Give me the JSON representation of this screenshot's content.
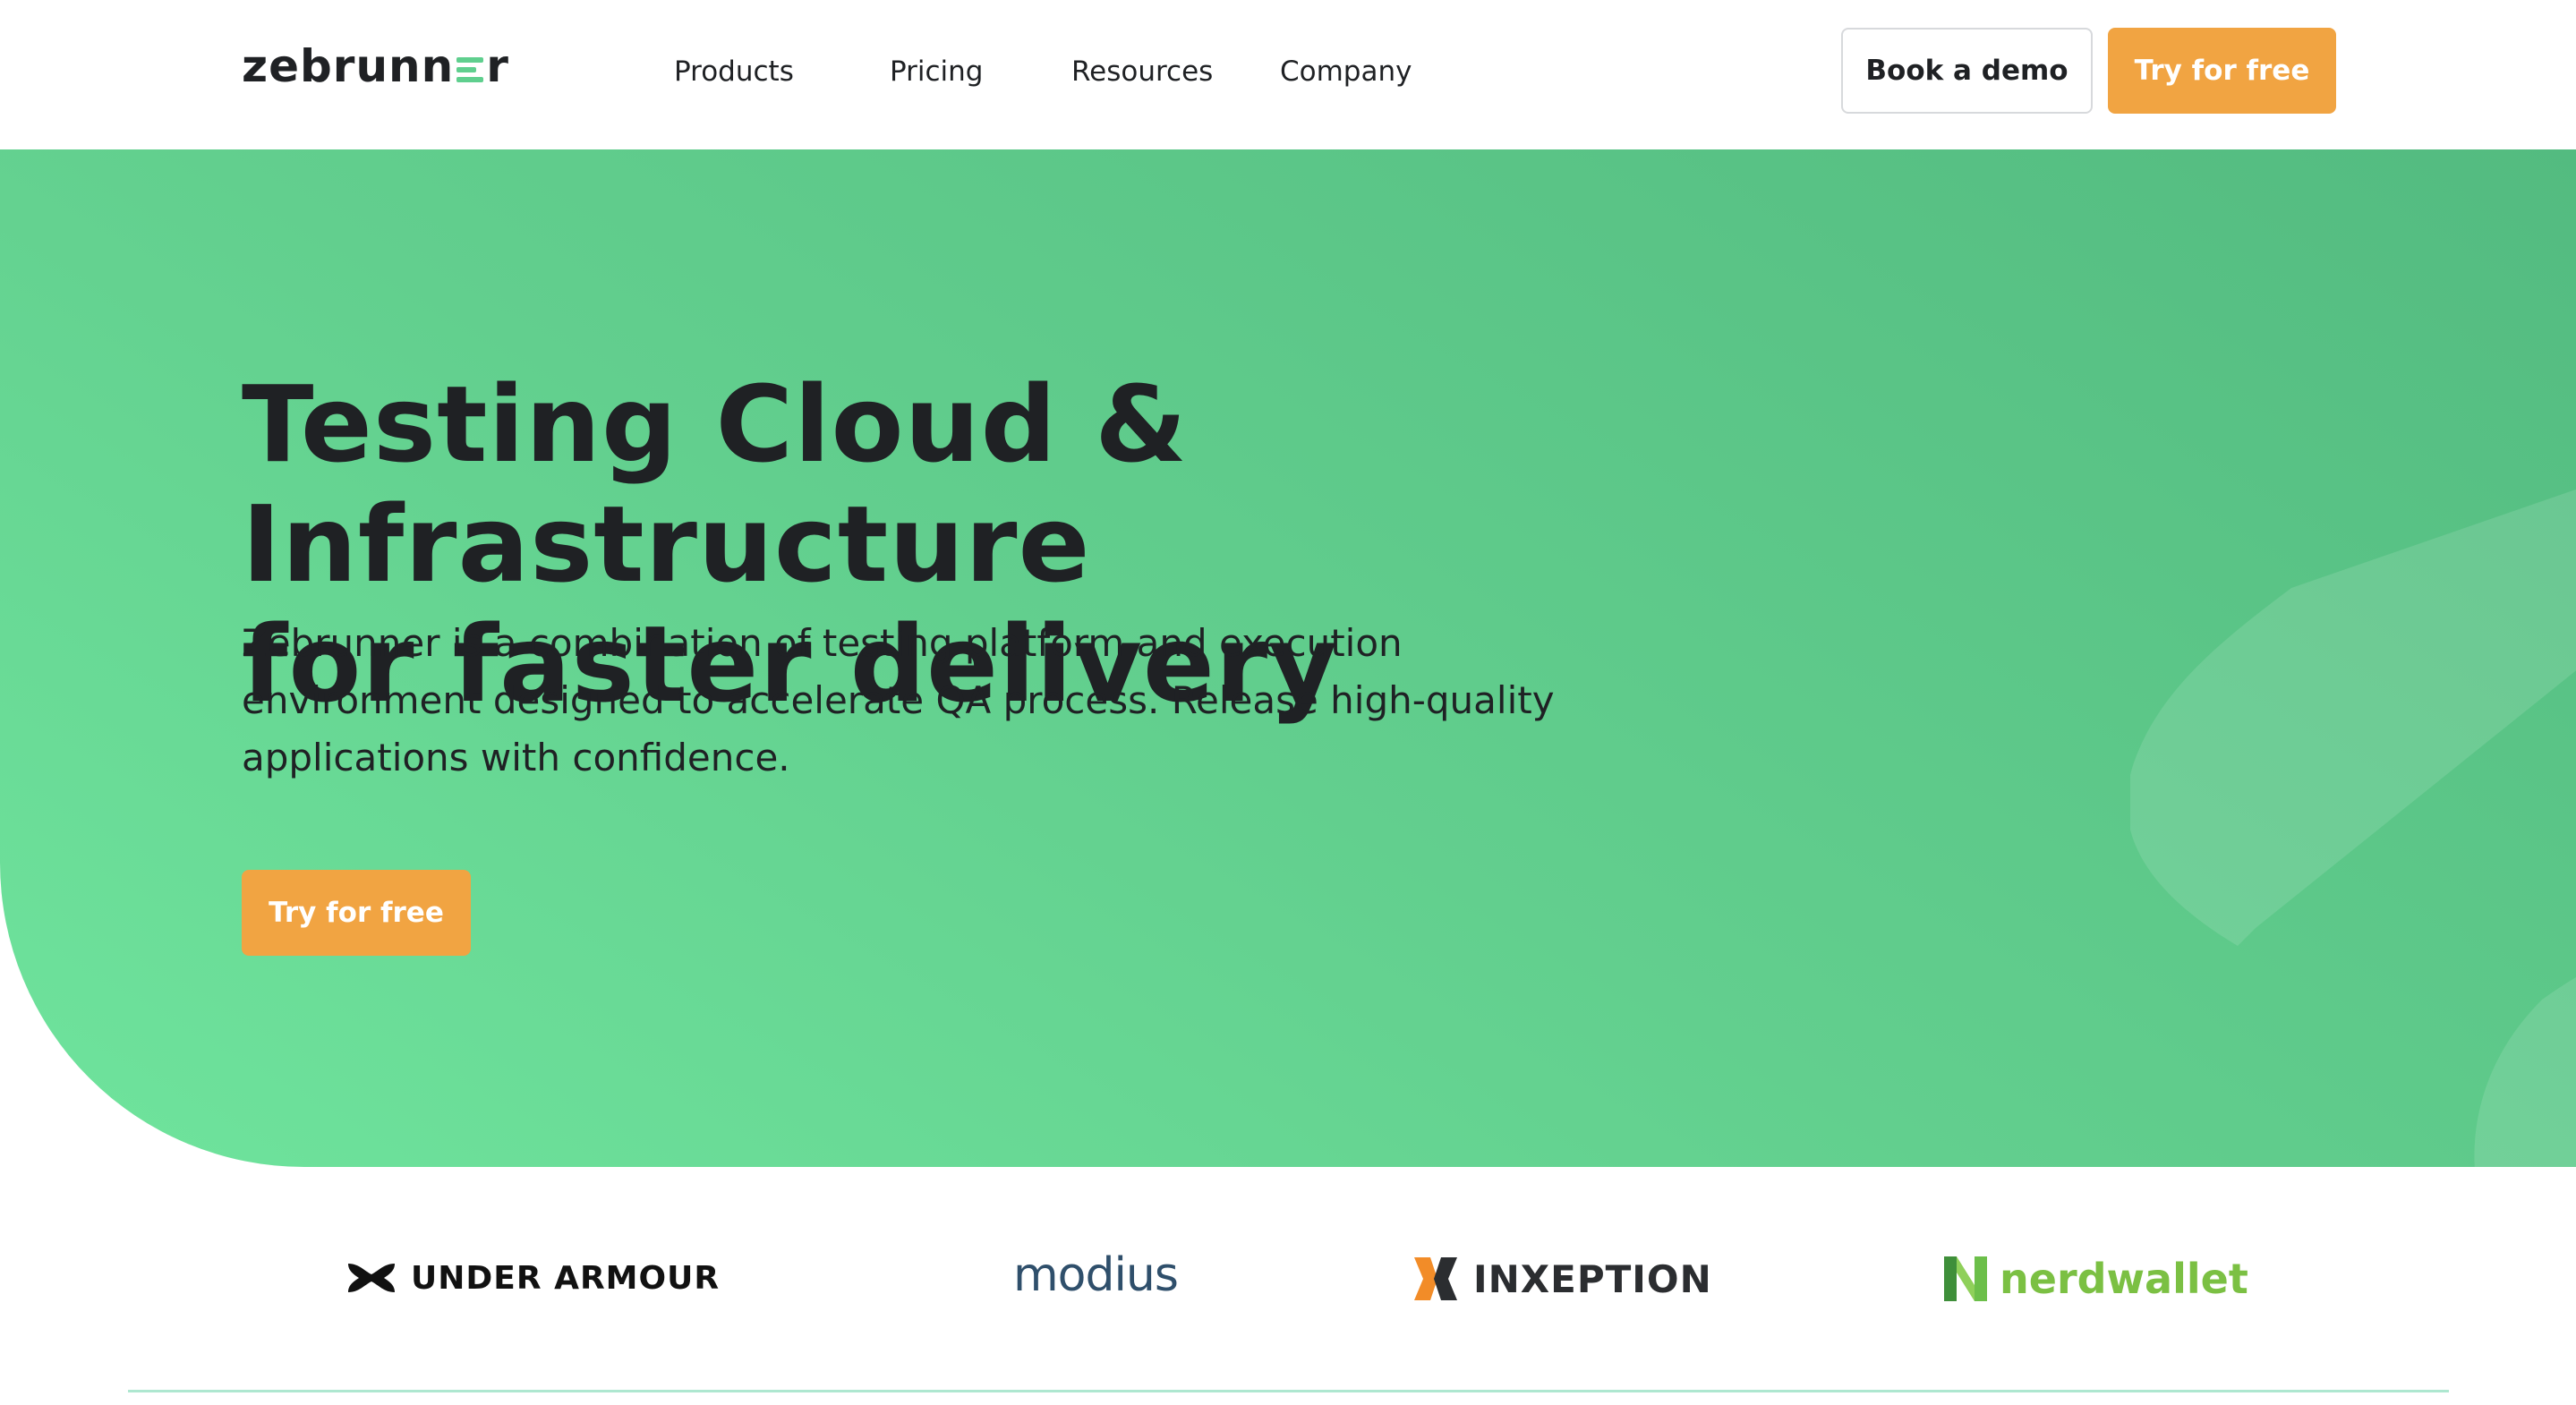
{
  "brand": {
    "logo_prefix": "zebrunn",
    "logo_suffix": "r",
    "accent": "#5fcf8e"
  },
  "nav": {
    "items": [
      {
        "label": "Products"
      },
      {
        "label": "Pricing"
      },
      {
        "label": "Resources"
      },
      {
        "label": "Company"
      }
    ],
    "book_demo_label": "Book a demo",
    "try_free_label": "Try for free"
  },
  "hero": {
    "title_line1": "Testing Cloud & Infrastructure",
    "title_line2": "for faster delivery",
    "subtitle": "Zebrunner is a combination of testing platform and execution environment designed to accelerate QA process. Release high-quality applications with confidence.",
    "cta_label": "Try for free",
    "cta_color": "#f1a442"
  },
  "clients": {
    "logos": [
      {
        "name": "UNDER ARMOUR",
        "icon": "under-armour-icon"
      },
      {
        "name": "modius",
        "icon": "modius-logo"
      },
      {
        "name": "INXEPTION",
        "icon": "inxeption-icon"
      },
      {
        "name": "nerdwallet",
        "icon": "nerdwallet-icon"
      }
    ]
  }
}
